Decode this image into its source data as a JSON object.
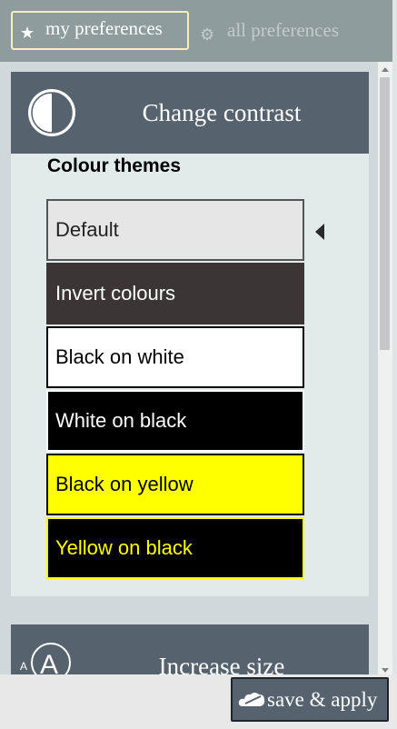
{
  "tabs": {
    "my_preferences": {
      "label": "my preferences",
      "icon": "star-icon"
    },
    "all_preferences": {
      "label": "all preferences",
      "icon": "gear-icon"
    }
  },
  "contrast_panel": {
    "title": "Change contrast",
    "icon": "contrast-icon",
    "heading": "Colour themes",
    "selected": "Default",
    "themes": [
      {
        "label": "Default",
        "bg": "#e6e6e6",
        "fg": "#222222",
        "border": "#555555"
      },
      {
        "label": "Invert colours",
        "bg": "#3b3536",
        "fg": "#ffffff",
        "border": "#3b3536"
      },
      {
        "label": "Black on white",
        "bg": "#ffffff",
        "fg": "#000000",
        "border": "#000000"
      },
      {
        "label": "White on black",
        "bg": "#000000",
        "fg": "#ffffff",
        "border": "#ffffff"
      },
      {
        "label": "Black on yellow",
        "bg": "#ffff00",
        "fg": "#000000",
        "border": "#000000"
      },
      {
        "label": "Yellow on black",
        "bg": "#000000",
        "fg": "#ffff00",
        "border": "#ffff00"
      }
    ]
  },
  "size_panel": {
    "title": "Increase size",
    "icon": "text-size-icon"
  },
  "footer": {
    "save_label": "save & apply",
    "icon": "cloud-icon"
  },
  "colors": {
    "panel_header": "#56636f",
    "panel_body": "#e1ebea",
    "topbar": "#8f9c9e",
    "tab_border": "#f4efbf"
  }
}
